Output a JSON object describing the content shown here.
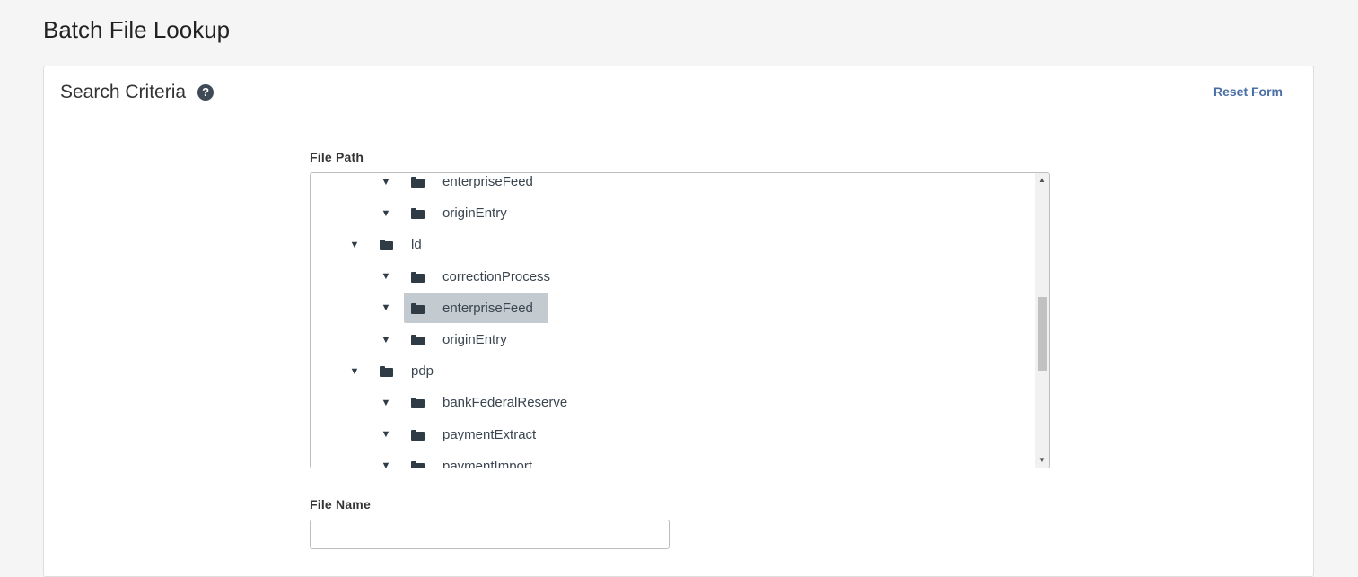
{
  "page": {
    "title": "Batch File Lookup"
  },
  "search_criteria": {
    "title": "Search Criteria",
    "help_icon": "?",
    "reset_label": "Reset Form"
  },
  "file_path": {
    "label": "File Path",
    "tree": [
      {
        "label": "enterpriseFeed",
        "level": 2,
        "expanded": true,
        "selected": false
      },
      {
        "label": "originEntry",
        "level": 2,
        "expanded": true,
        "selected": false
      },
      {
        "label": "ld",
        "level": 1,
        "expanded": true,
        "selected": false
      },
      {
        "label": "correctionProcess",
        "level": 2,
        "expanded": true,
        "selected": false
      },
      {
        "label": "enterpriseFeed",
        "level": 2,
        "expanded": true,
        "selected": true
      },
      {
        "label": "originEntry",
        "level": 2,
        "expanded": true,
        "selected": false
      },
      {
        "label": "pdp",
        "level": 1,
        "expanded": true,
        "selected": false
      },
      {
        "label": "bankFederalReserve",
        "level": 2,
        "expanded": true,
        "selected": false
      },
      {
        "label": "paymentExtract",
        "level": 2,
        "expanded": true,
        "selected": false
      },
      {
        "label": "paymentImport",
        "level": 2,
        "expanded": true,
        "selected": false
      }
    ],
    "caret_glyph": "▼",
    "folder_icon": "folder-icon",
    "scroll_up_glyph": "▲",
    "scroll_down_glyph": "▼"
  },
  "file_name": {
    "label": "File Name",
    "value": "",
    "placeholder": ""
  },
  "colors": {
    "accent_link": "#4a6fa5",
    "selected_node_bg": "#c3cbd1",
    "icon_dark": "#2f3b45"
  }
}
